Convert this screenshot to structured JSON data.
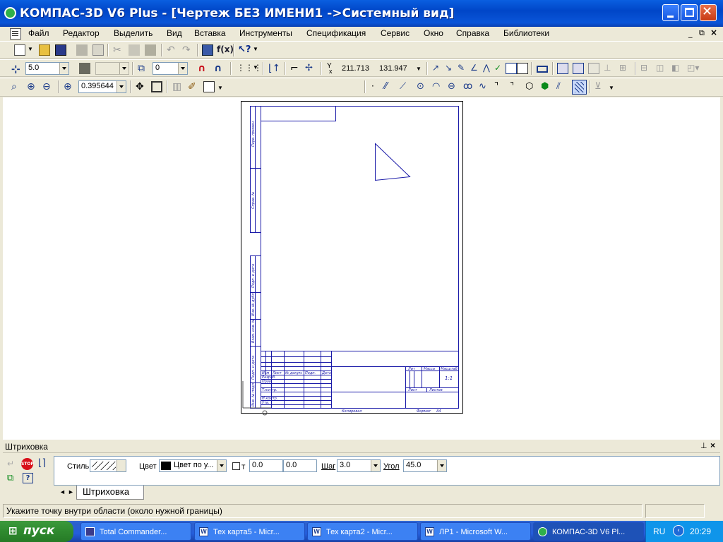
{
  "window": {
    "title": "КОМПАС-3D V6 Plus - [Чертеж БЕЗ ИМЕНИ1 ->Системный вид]"
  },
  "menu": [
    "Файл",
    "Редактор",
    "Выделить",
    "Вид",
    "Вставка",
    "Инструменты",
    "Спецификация",
    "Сервис",
    "Окно",
    "Справка",
    "Библиотеки"
  ],
  "toolbar2": {
    "step": "5.0",
    "layer": "0",
    "x_label": "Y",
    "x_value": "211.713",
    "y_value": "131.947"
  },
  "toolbar3": {
    "zoom": "0.395644"
  },
  "panel": {
    "title": "Штриховка",
    "style_label": "Стиль",
    "color_label": "Цвет",
    "color_value": "Цвет по у...",
    "t_label": "Т",
    "t_x": "0.0",
    "t_y": "0.0",
    "step_label": "Шаг",
    "step_value": "3.0",
    "angle_label": "Угол",
    "angle_value": "45.0",
    "tab": "Штриховка",
    "stop": "STOP"
  },
  "status": {
    "message": "Укажите точку внутри области (около нужной границы)"
  },
  "taskbar": {
    "start": "пуск",
    "tasks": [
      {
        "label": "Total Commander...",
        "icon": "floppy-icon"
      },
      {
        "label": "Тех карта5 - Micr...",
        "icon": "word-icon"
      },
      {
        "label": "Тех карта2 - Micr...",
        "icon": "word-icon"
      },
      {
        "label": "ЛР1 - Microsoft W...",
        "icon": "word-icon"
      },
      {
        "label": "КОМПАС-3D V6 Pl...",
        "icon": "kompas-icon"
      }
    ],
    "lang": "RU",
    "time": "20:29"
  },
  "drawing": {
    "title_block": {
      "col_labels": [
        "Изм",
        "Лист",
        "№ докум.",
        "Подп.",
        "Дата"
      ],
      "row_labels": [
        "Разраб.",
        "Пров.",
        "Т.контр.",
        "Н.контр.",
        "Утв."
      ],
      "lit": "Лит",
      "mass": "Масса",
      "scale": "Масштаб",
      "scale_value": "1:1",
      "sheet": "Лист",
      "sheets": "Листов",
      "copied": "Копировал",
      "format": "Формат",
      "format_value": "А4"
    },
    "side_labels": [
      "Перв. примен.",
      "Справ. №",
      "Подп. и дата",
      "Инв. № дубл.",
      "Взам. инв. №",
      "Подп. и дата",
      "Инв. № подл."
    ]
  },
  "colors": {
    "drawing_line": "#1a1aa8",
    "titlebar": "#0a5fe0",
    "taskbar": "#245edb"
  }
}
